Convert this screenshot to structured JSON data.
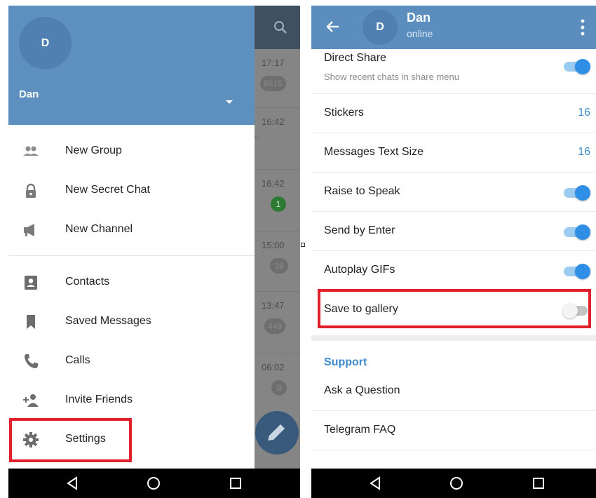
{
  "left": {
    "chats": [
      {
        "time": "17:17",
        "badge": "8615"
      },
      {
        "time": "16:42",
        "badge": ""
      },
      {
        "time": "16:42",
        "badge": "1"
      },
      {
        "time": "15:00",
        "badge": "38"
      },
      {
        "time": "13:47",
        "badge": "449"
      },
      {
        "time": "06:02",
        "badge": "9"
      }
    ],
    "drawer": {
      "avatar_initial": "D",
      "user_name": "Dan",
      "items": [
        {
          "label": "New Group",
          "icon": "group-icon"
        },
        {
          "label": "New Secret Chat",
          "icon": "lock-icon"
        },
        {
          "label": "New Channel",
          "icon": "megaphone-icon"
        },
        {
          "label": "Contacts",
          "icon": "contact-card-icon"
        },
        {
          "label": "Saved Messages",
          "icon": "bookmark-icon"
        },
        {
          "label": "Calls",
          "icon": "phone-icon"
        },
        {
          "label": "Invite Friends",
          "icon": "add-person-icon"
        },
        {
          "label": "Settings",
          "icon": "gear-icon"
        }
      ]
    }
  },
  "right": {
    "header": {
      "avatar_initial": "D",
      "name": "Dan",
      "status": "online"
    },
    "settings": [
      {
        "label": "Direct Share",
        "sub": "Show recent chats in share menu",
        "toggle": true
      },
      {
        "label": "Stickers",
        "value": "16"
      },
      {
        "label": "Messages Text Size",
        "value": "16"
      },
      {
        "label": "Raise to Speak",
        "toggle": true
      },
      {
        "label": "Send by Enter",
        "toggle": true
      },
      {
        "label": "Autoplay GIFs",
        "toggle": true
      },
      {
        "label": "Save to gallery",
        "toggle": false
      }
    ],
    "support": {
      "header": "Support",
      "items": [
        "Ask a Question",
        "Telegram FAQ"
      ]
    }
  },
  "colors": {
    "header_blue": "#5b8dbf",
    "accent_blue": "#3d8ad0",
    "toggle_on": "#2f8fe6",
    "highlight_red": "#e0202a"
  }
}
